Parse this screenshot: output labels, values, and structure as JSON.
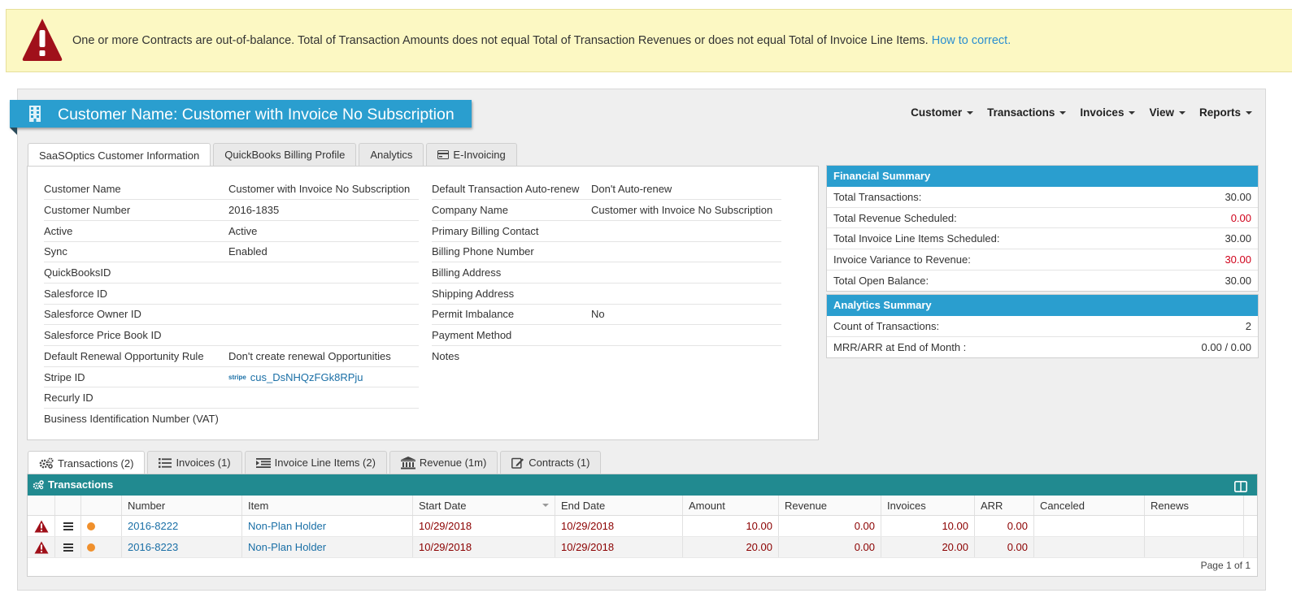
{
  "alert": {
    "message": "One or more Contracts are out-of-balance. Total of Transaction Amounts does not equal Total of Transaction Revenues or does not equal Total of Invoice Line Items.",
    "link": "How to correct."
  },
  "page": {
    "title": "Customer Name: Customer with Invoice No Subscription"
  },
  "nav": [
    {
      "label": "Customer"
    },
    {
      "label": "Transactions"
    },
    {
      "label": "Invoices"
    },
    {
      "label": "View"
    },
    {
      "label": "Reports"
    }
  ],
  "info_tabs": [
    {
      "label": "SaaSOptics Customer Information",
      "active": true
    },
    {
      "label": "QuickBooks Billing Profile"
    },
    {
      "label": "Analytics"
    },
    {
      "label": "E-Invoicing",
      "icon": "credit-card-icon"
    }
  ],
  "left_fields": [
    {
      "label": "Customer Name",
      "value": "Customer with Invoice No Subscription"
    },
    {
      "label": "Customer Number",
      "value": "2016-1835"
    },
    {
      "label": "Active",
      "value": "Active"
    },
    {
      "label": "Sync",
      "value": "Enabled"
    },
    {
      "label": "QuickBooksID",
      "value": ""
    },
    {
      "label": "Salesforce ID",
      "value": ""
    },
    {
      "label": "Salesforce Owner ID",
      "value": ""
    },
    {
      "label": "Salesforce Price Book ID",
      "value": ""
    },
    {
      "label": "Default Renewal Opportunity Rule",
      "value": "Don't create renewal Opportunities"
    },
    {
      "label": "Stripe ID",
      "value": "cus_DsNHQzFGk8RPju",
      "prefix": "stripe"
    },
    {
      "label": "Recurly ID",
      "value": ""
    },
    {
      "label": "Business Identification Number (VAT)",
      "value": ""
    }
  ],
  "right_fields": [
    {
      "label": "Default Transaction Auto-renew",
      "value": "Don't Auto-renew"
    },
    {
      "label": "Company Name",
      "value": "Customer with Invoice No Subscription"
    },
    {
      "label": "Primary Billing Contact",
      "value": ""
    },
    {
      "label": "Billing Phone Number",
      "value": ""
    },
    {
      "label": "Billing Address",
      "value": ""
    },
    {
      "label": "Shipping Address",
      "value": ""
    },
    {
      "label": "Permit Imbalance",
      "value": "No"
    },
    {
      "label": "Payment Method",
      "value": ""
    },
    {
      "label": "Notes",
      "value": ""
    }
  ],
  "financial_summary": {
    "title": "Financial Summary",
    "rows": [
      {
        "label": "Total Transactions:",
        "value": "30.00"
      },
      {
        "label": "Total Revenue Scheduled:",
        "value": "0.00",
        "red": true
      },
      {
        "label": "Total Invoice Line Items Scheduled:",
        "value": "30.00"
      },
      {
        "label": "Invoice Variance to Revenue:",
        "value": "30.00",
        "red": true
      },
      {
        "label": "Total Open Balance:",
        "value": "30.00"
      }
    ]
  },
  "analytics_summary": {
    "title": "Analytics Summary",
    "rows": [
      {
        "label": "Count of Transactions:",
        "value": "2"
      },
      {
        "label": "MRR/ARR at End of Month :",
        "value": "0.00 / 0.00"
      }
    ]
  },
  "bottom_tabs": [
    {
      "label": "Transactions (2)",
      "icon": "gears-icon",
      "active": true
    },
    {
      "label": "Invoices (1)",
      "icon": "list-icon"
    },
    {
      "label": "Invoice Line Items (2)",
      "icon": "indent-list-icon"
    },
    {
      "label": "Revenue (1m)",
      "icon": "bank-icon"
    },
    {
      "label": "Contracts (1)",
      "icon": "edit-doc-icon"
    }
  ],
  "grid": {
    "title": "Transactions",
    "columns": [
      "Number",
      "Item",
      "Start Date",
      "End Date",
      "Amount",
      "Revenue",
      "Invoices",
      "ARR",
      "Canceled",
      "Renews"
    ],
    "rows": [
      {
        "number": "2016-8222",
        "item": "Non-Plan Holder",
        "start": "10/29/2018",
        "end": "10/29/2018",
        "amount": "10.00",
        "revenue": "0.00",
        "invoices": "10.00",
        "arr": "0.00",
        "canceled": "",
        "renews": ""
      },
      {
        "number": "2016-8223",
        "item": "Non-Plan Holder",
        "start": "10/29/2018",
        "end": "10/29/2018",
        "amount": "20.00",
        "revenue": "0.00",
        "invoices": "20.00",
        "arr": "0.00",
        "canceled": "",
        "renews": ""
      }
    ],
    "pager": "Page 1 of 1"
  },
  "colors": {
    "accent": "#2a9ecf",
    "grid_header": "#218a90",
    "alert_bg": "#fcf8c3",
    "warning": "#a0101a",
    "status_dot": "#f0902c"
  }
}
